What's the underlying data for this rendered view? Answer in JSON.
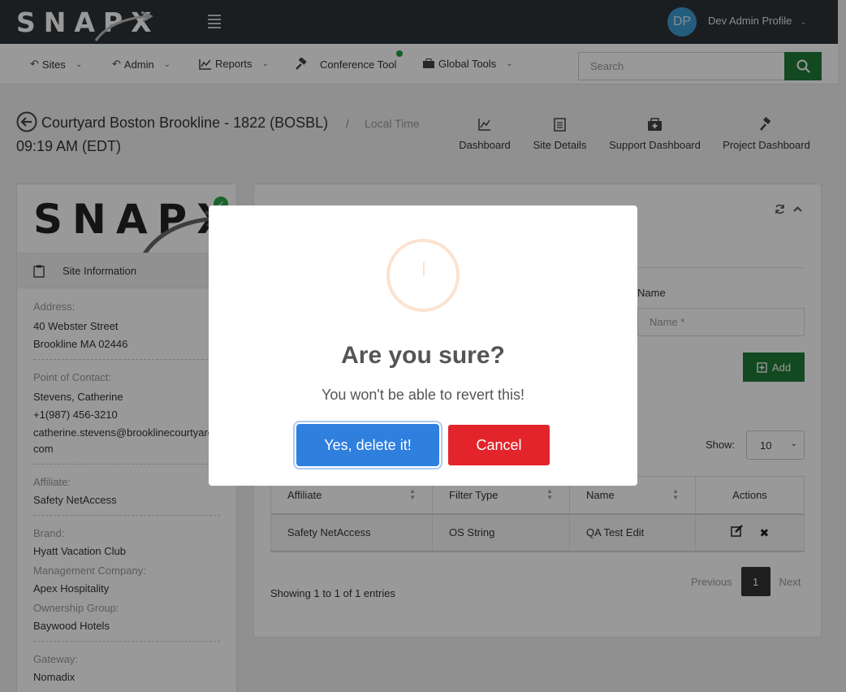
{
  "brand": {
    "logo_text": "SNAPX"
  },
  "profile": {
    "initials": "DP",
    "name": "Dev Admin Profile"
  },
  "nav": {
    "items": [
      {
        "label": "Sites",
        "icon": "sites-icon"
      },
      {
        "label": "Admin",
        "icon": "admin-icon"
      },
      {
        "label": "Reports",
        "icon": "chart-icon"
      },
      {
        "label": "Conference Tool",
        "icon": "gavel-icon"
      },
      {
        "label": "Global Tools",
        "icon": "briefcase-icon"
      }
    ],
    "search_placeholder": "Search"
  },
  "header": {
    "site_title": "Courtyard Boston Brookline - 1822 (BOSBL)",
    "separator": "/",
    "local_time_label": "Local Time",
    "local_time": "09:19 AM (EDT)",
    "links": [
      "Dashboard",
      "Site Details",
      "Support Dashboard",
      "Project Dashboard"
    ]
  },
  "site_info": {
    "tab_label": "Site Information",
    "address_label": "Address:",
    "address_line1": "40 Webster Street",
    "address_line2": "Brookline MA 02446",
    "poc_label": "Point of Contact:",
    "poc_name": "Stevens, Catherine",
    "poc_phone": "+1(987) 456-3210",
    "poc_email_1": "catherine.stevens@brooklinecourtyard.",
    "poc_email_2": "com",
    "affiliate_label": "Affiliate:",
    "affiliate": "Safety NetAccess",
    "brand_label": "Brand:",
    "brand": "Hyatt Vacation Club",
    "mgmt_label": "Management Company:",
    "mgmt": "Apex Hospitality",
    "ownership_label": "Ownership Group:",
    "ownership": "Baywood Hotels",
    "gateway_label": "Gateway:",
    "gateway": "Nomadix"
  },
  "form": {
    "name_label": "Name",
    "name_placeholder": "Name *",
    "add_label": "Add"
  },
  "table": {
    "show_label": "Show:",
    "page_size": "10",
    "columns": [
      "Affiliate",
      "Filter Type",
      "Name",
      "Actions"
    ],
    "rows": [
      {
        "affiliate": "Safety NetAccess",
        "filter_type": "OS String",
        "name": "QA Test Edit"
      }
    ],
    "showing": "Showing 1 to 1 of 1 entries",
    "pager": {
      "prev": "Previous",
      "current": "1",
      "next": "Next"
    }
  },
  "modal": {
    "title": "Are you sure?",
    "text": "You won't be able to revert this!",
    "confirm_label": "Yes, delete it!",
    "cancel_label": "Cancel"
  },
  "colors": {
    "topbar": "#2d3238",
    "accent_green": "#217a38",
    "confirm_blue": "#2f7fdf",
    "cancel_red": "#e3242b"
  }
}
